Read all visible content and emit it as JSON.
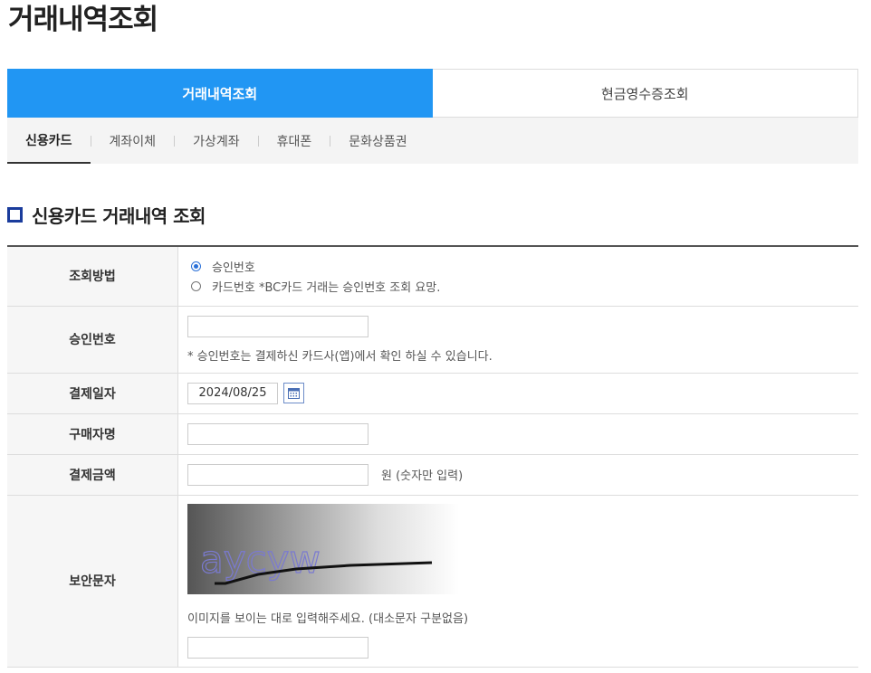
{
  "page_title": "거래내역조회",
  "main_tabs": [
    {
      "label": "거래내역조회",
      "active": true
    },
    {
      "label": "현금영수증조회",
      "active": false
    }
  ],
  "sub_tabs": [
    {
      "label": "신용카드",
      "active": true
    },
    {
      "label": "계좌이체",
      "active": false
    },
    {
      "label": "가상계좌",
      "active": false
    },
    {
      "label": "휴대폰",
      "active": false
    },
    {
      "label": "문화상품권",
      "active": false
    }
  ],
  "section_title": "신용카드 거래내역 조회",
  "form": {
    "method": {
      "label": "조회방법",
      "options": [
        {
          "label": "승인번호",
          "selected": true
        },
        {
          "label": "카드번호 *BC카드 거래는 승인번호 조회 요망.",
          "selected": false
        }
      ]
    },
    "approval": {
      "label": "승인번호",
      "value": "",
      "note": "* 승인번호는 결제하신 카드사(앱)에서 확인 하실 수 있습니다."
    },
    "pay_date": {
      "label": "결제일자",
      "value": "2024/08/25",
      "icon": "calendar-icon"
    },
    "buyer": {
      "label": "구매자명",
      "value": ""
    },
    "amount": {
      "label": "결제금액",
      "value": "",
      "suffix": "원 (숫자만 입력)"
    },
    "captcha": {
      "label": "보안문자",
      "image_text": "aycyw",
      "note": "이미지를 보이는 대로 입력해주세요. (대소문자 구분없음)",
      "value": ""
    }
  },
  "colors": {
    "accent": "#2196f3",
    "section_icon": "#1a3c9c"
  }
}
